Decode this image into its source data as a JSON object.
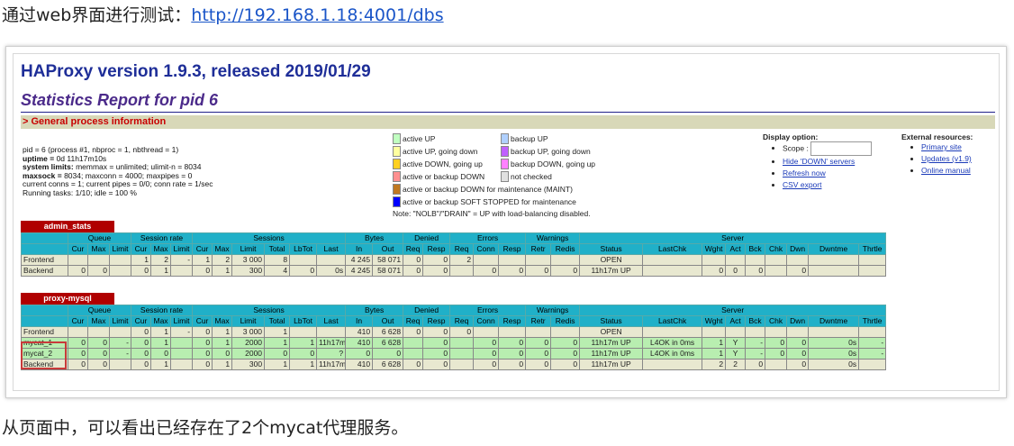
{
  "intro": {
    "prefix": "通过web界面进行测试：",
    "link": "http://192.168.1.18:4001/dbs"
  },
  "outro": "从页面中，可以看出已经存在了2个mycat代理服务。",
  "page": {
    "title": "HAProxy version 1.9.3, released 2019/01/29",
    "subtitle": "Statistics Report for pid 6",
    "section": "> General process information"
  },
  "process_info": [
    {
      "b": "",
      "t": "pid = 6 (process #1, nbproc = 1, nbthread = 1)"
    },
    {
      "b": "uptime = ",
      "t": "0d 11h17m10s"
    },
    {
      "b": "system limits: ",
      "t": "memmax = unlimited; ulimit-n = 8034"
    },
    {
      "b": "maxsock = ",
      "t": "8034; maxconn = 4000; maxpipes = 0"
    },
    {
      "b": "",
      "t": "current conns = 1; current pipes = 0/0; conn rate = 1/sec"
    },
    {
      "b": "",
      "t": "Running tasks: 1/10; idle = 100 %"
    }
  ],
  "legend": {
    "items": [
      {
        "label": "active UP",
        "color": "#c0ffc0"
      },
      {
        "label": "backup UP",
        "color": "#b0d0ff"
      },
      {
        "label": "active UP, going down",
        "color": "#ffffa0"
      },
      {
        "label": "backup UP, going down",
        "color": "#c060ff"
      },
      {
        "label": "active DOWN, going up",
        "color": "#ffd020"
      },
      {
        "label": "backup DOWN, going up",
        "color": "#ff80ff"
      },
      {
        "label": "active or backup DOWN",
        "color": "#ff9090"
      },
      {
        "label": "not checked",
        "color": "#e0e0e0"
      },
      {
        "label": "active or backup DOWN for maintenance (MAINT)",
        "color": "#c07820"
      },
      {
        "label": "active or backup SOFT STOPPED for maintenance",
        "color": "#0000ff"
      }
    ],
    "note": "Note: \"NOLB\"/\"DRAIN\" = UP with load-balancing disabled."
  },
  "display_options": {
    "title": "Display option:",
    "scope_label": "Scope :",
    "links": [
      "Hide 'DOWN' servers",
      "Refresh now",
      "CSV export"
    ]
  },
  "external": {
    "title": "External resources:",
    "links": [
      "Primary site",
      "Updates (v1.9)",
      "Online manual"
    ]
  },
  "admin_stats": {
    "name": "admin_stats",
    "rows": [
      [
        "Frontend",
        "",
        "",
        "",
        "1",
        "2",
        "-",
        "1",
        "2",
        "3 000",
        "8",
        "",
        "",
        "4 245",
        "58 071",
        "0",
        "0",
        "2",
        "",
        "",
        "",
        "",
        "OPEN",
        "",
        "",
        "",
        "",
        "",
        "",
        "",
        "",
        ""
      ],
      [
        "Backend",
        "0",
        "0",
        "",
        "0",
        "1",
        "",
        "0",
        "1",
        "300",
        "4",
        "0",
        "0s",
        "4 245",
        "58 071",
        "0",
        "0",
        "",
        "0",
        "0",
        "0",
        "0",
        "11h17m UP",
        "",
        "0",
        "0",
        "0",
        "",
        "0",
        "",
        ""
      ]
    ]
  },
  "proxy_mysql": {
    "name": "proxy-mysql",
    "rows": [
      [
        "Frontend",
        "",
        "",
        "",
        "0",
        "1",
        "-",
        "0",
        "1",
        "3 000",
        "1",
        "",
        "",
        "410",
        "6 628",
        "0",
        "0",
        "0",
        "",
        "",
        "",
        "",
        "OPEN",
        "",
        "",
        "",
        "",
        "",
        "",
        "",
        "",
        ""
      ],
      [
        "mycat_1",
        "0",
        "0",
        "-",
        "0",
        "1",
        "",
        "0",
        "1",
        "2000",
        "1",
        "1",
        "11h17m",
        "410",
        "6 628",
        "",
        "0",
        "",
        "0",
        "0",
        "0",
        "0",
        "11h17m UP",
        "L4OK in 0ms",
        "1",
        "Y",
        "-",
        "0",
        "0",
        "0s",
        "-"
      ],
      [
        "mycat_2",
        "0",
        "0",
        "-",
        "0",
        "0",
        "",
        "0",
        "0",
        "2000",
        "0",
        "0",
        "?",
        "0",
        "0",
        "",
        "0",
        "",
        "0",
        "0",
        "0",
        "0",
        "11h17m UP",
        "L4OK in 0ms",
        "1",
        "Y",
        "-",
        "0",
        "0",
        "0s",
        "-"
      ],
      [
        "Backend",
        "0",
        "0",
        "",
        "0",
        "1",
        "",
        "0",
        "1",
        "300",
        "1",
        "1",
        "11h17m",
        "410",
        "6 628",
        "0",
        "0",
        "",
        "0",
        "0",
        "0",
        "0",
        "11h17m UP",
        "",
        "2",
        "2",
        "0",
        "",
        "0",
        "0s",
        ""
      ]
    ]
  },
  "headers": {
    "groups": [
      "Queue",
      "Session rate",
      "Sessions",
      "Bytes",
      "Denied",
      "Errors",
      "Warnings",
      "Server"
    ],
    "cols": [
      "Cur",
      "Max",
      "Limit",
      "Cur",
      "Max",
      "Limit",
      "Cur",
      "Max",
      "Limit",
      "Total",
      "LbTot",
      "Last",
      "In",
      "Out",
      "Req",
      "Resp",
      "Req",
      "Conn",
      "Resp",
      "Retr",
      "Redis",
      "Status",
      "LastChk",
      "Wght",
      "Act",
      "Bck",
      "Chk",
      "Dwn",
      "Dwntme",
      "Thrtle"
    ]
  }
}
